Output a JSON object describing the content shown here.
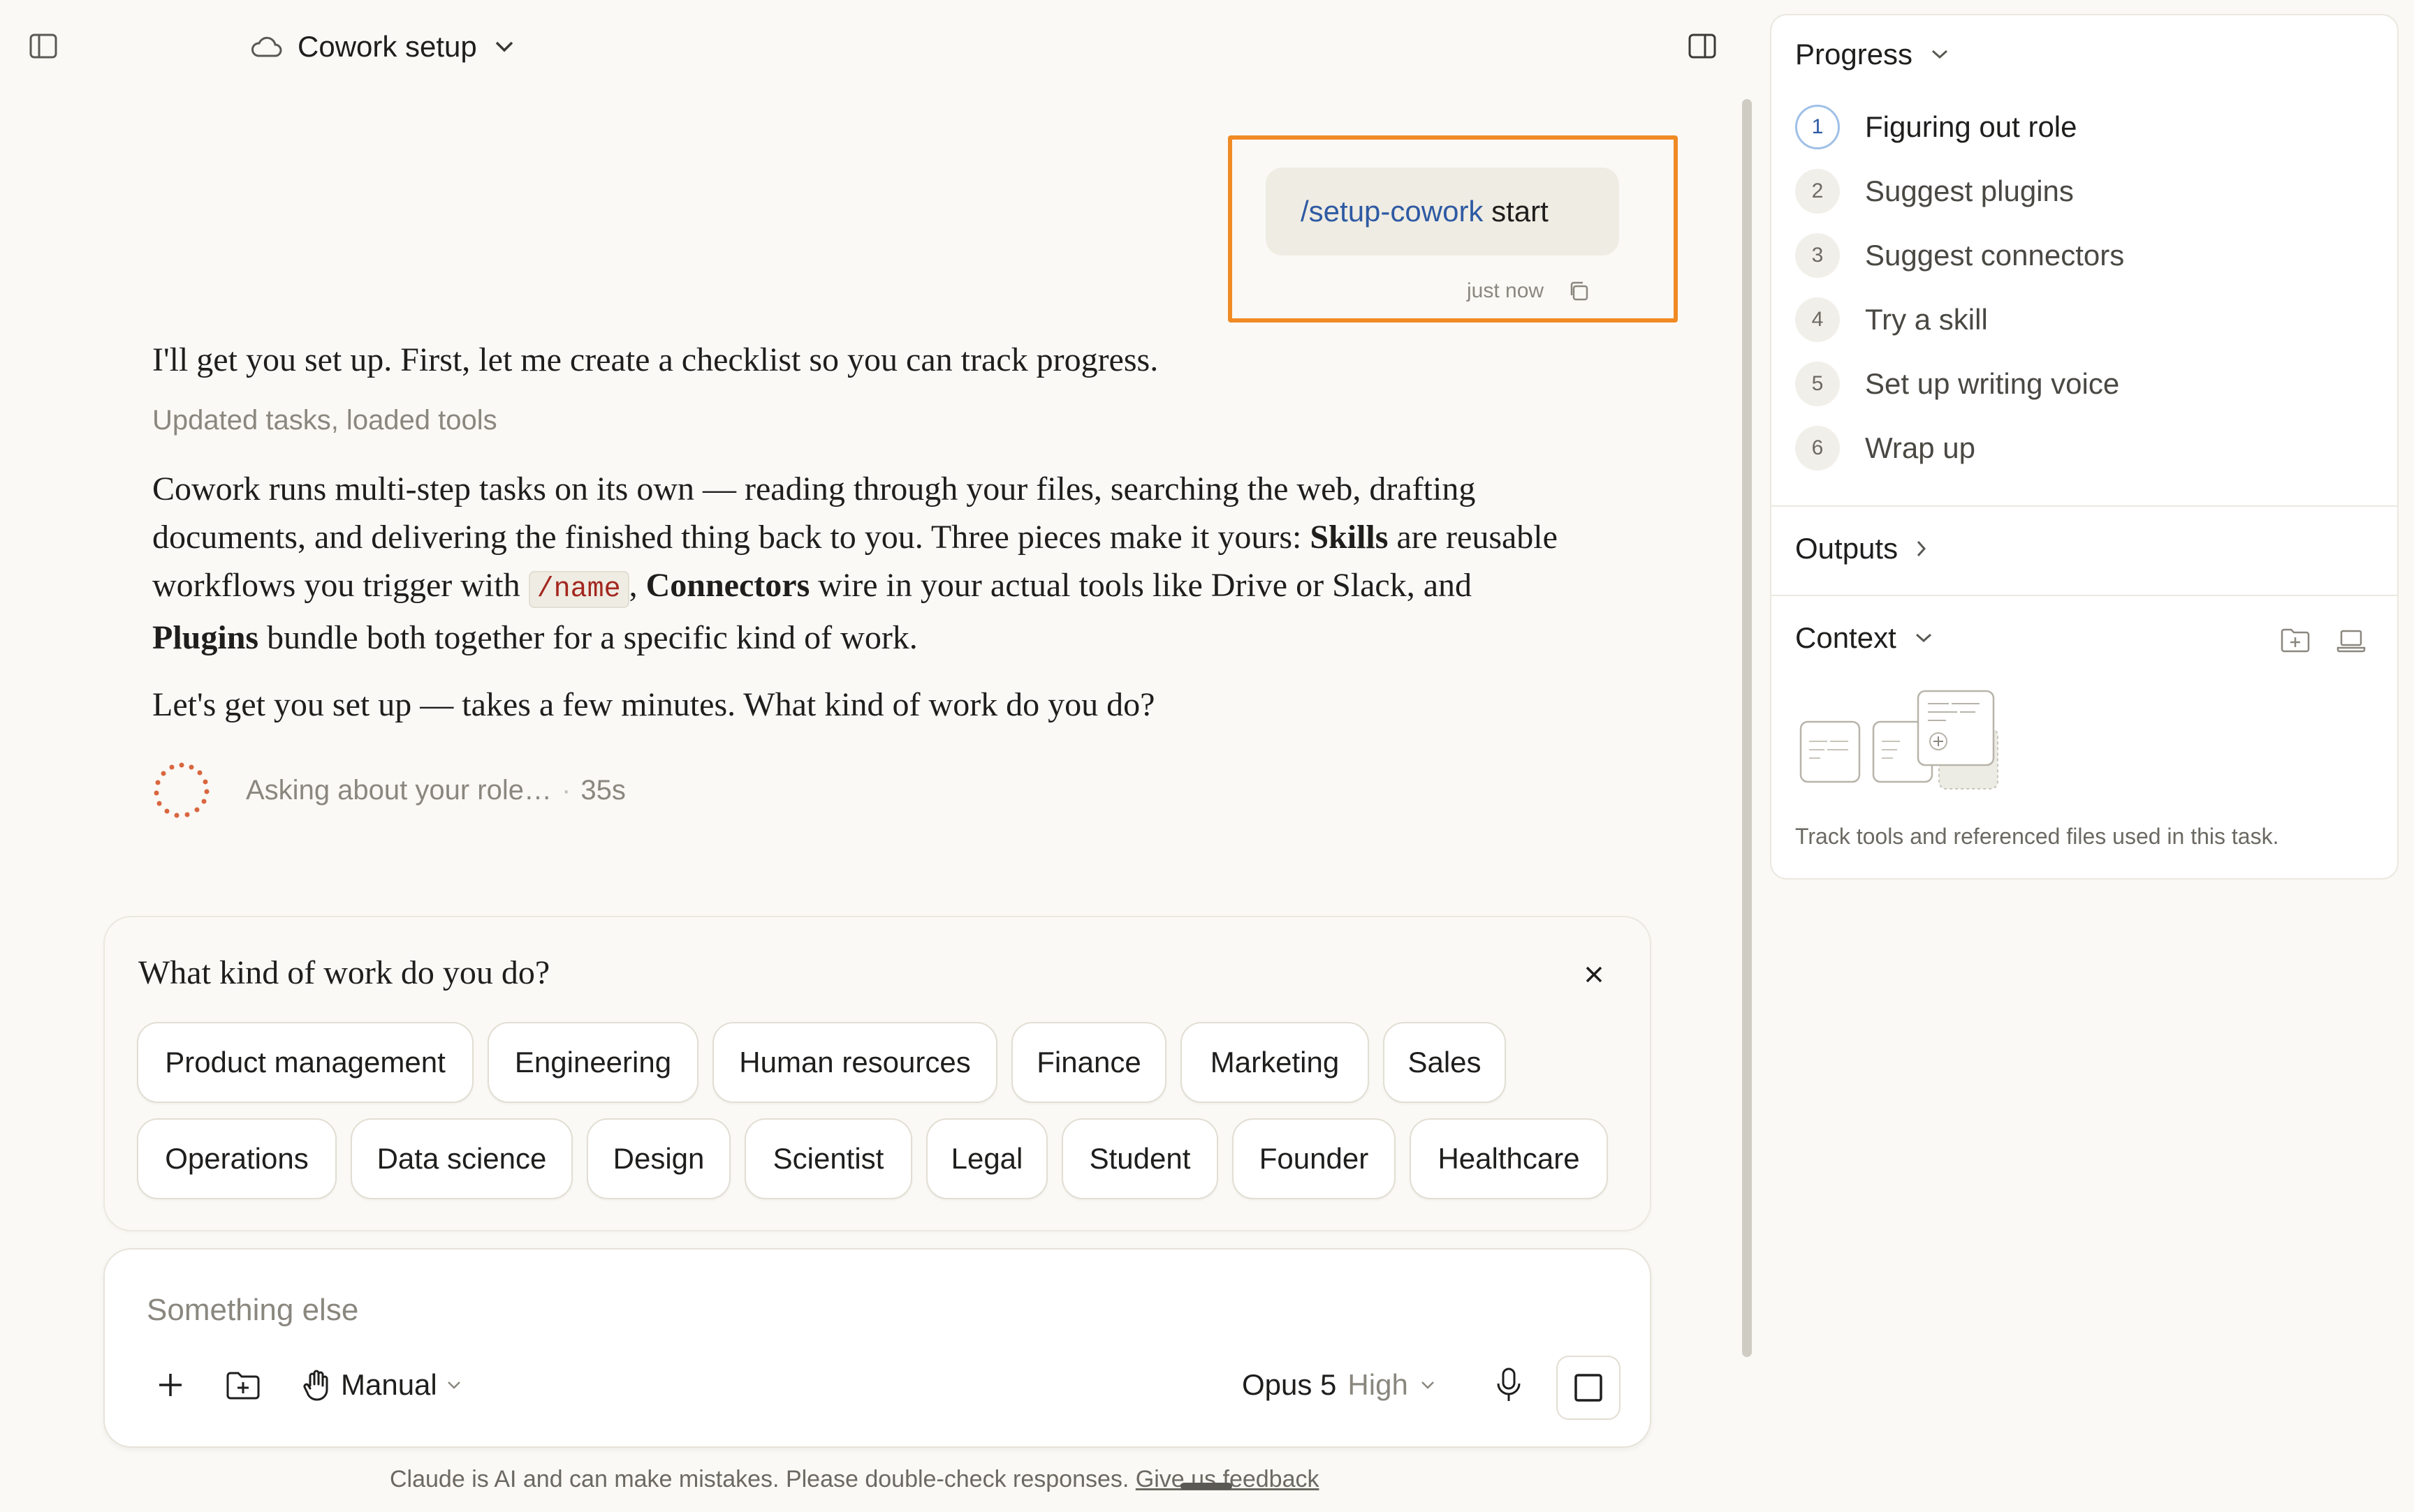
{
  "header": {
    "title": "Cowork setup"
  },
  "user_message": {
    "slash": "/",
    "command": "setup-cowork",
    "argument": " start",
    "time": "just now"
  },
  "assistant": {
    "intro": "I'll get you set up. First, let me create a checklist so you can track progress.",
    "tools_status": "Updated tasks, loaded tools",
    "body": {
      "t1": "Cowork runs multi-step tasks on its own — reading through your files, searching the web, drafting documents, and delivering the finished thing back to you. Three pieces make it yours: ",
      "skills": "Skills",
      "t2": " are reusable workflows you trigger with ",
      "code": "/name",
      "t3": ", ",
      "connectors": "Connectors",
      "t4": " wire in your actual tools like Drive or Slack, and ",
      "plugins": "Plugins",
      "t5": " bundle both together for a specific kind of work."
    },
    "question": "Let's get you set up — takes a few minutes. What kind of work do you do?",
    "thinking": "Asking about your role…",
    "thinking_time": "35s"
  },
  "question_card": {
    "title": "What kind of work do you do?",
    "options_row1": [
      "Product management",
      "Engineering",
      "Human resources",
      "Finance",
      "Marketing",
      "Sales"
    ],
    "options_row2": [
      "Operations",
      "Data science",
      "Design",
      "Scientist",
      "Legal",
      "Student",
      "Founder",
      "Healthcare"
    ]
  },
  "composer": {
    "placeholder": "Something else",
    "mode": "Manual",
    "model": "Opus 5",
    "effort": "High"
  },
  "footer": {
    "disclaimer": "Claude is AI and can make mistakes. Please double-check responses. ",
    "feedback_link": "Give us feedback"
  },
  "panel": {
    "progress_title": "Progress",
    "steps": [
      {
        "num": "1",
        "label": "Figuring out role"
      },
      {
        "num": "2",
        "label": "Suggest plugins"
      },
      {
        "num": "3",
        "label": "Suggest connectors"
      },
      {
        "num": "4",
        "label": "Try a skill"
      },
      {
        "num": "5",
        "label": "Set up writing voice"
      },
      {
        "num": "6",
        "label": "Wrap up"
      }
    ],
    "active_step": 1,
    "outputs_title": "Outputs",
    "context_title": "Context",
    "context_hint": "Track tools and referenced files used in this task."
  },
  "colors": {
    "accent_orange": "#f08a24",
    "spinner": "#d9663f",
    "link_blue": "#2e5aa3",
    "background": "#faf9f5"
  }
}
